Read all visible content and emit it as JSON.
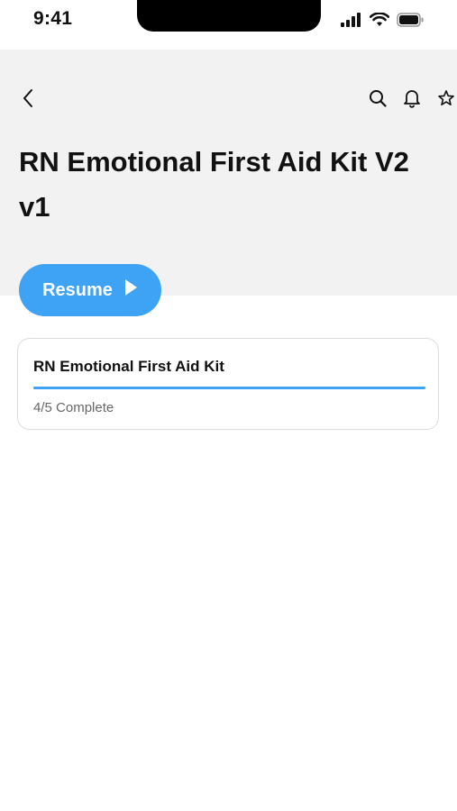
{
  "status_bar": {
    "time": "9:41"
  },
  "header": {
    "title": "RN Emotional First Aid Kit V2 v1",
    "icons": [
      "chevron-left-icon",
      "search-icon",
      "bell-icon",
      "star-icon"
    ]
  },
  "resume_button": {
    "label": "Resume"
  },
  "course_card": {
    "title": "RN Emotional First Aid Kit",
    "progress_fraction": 0.8,
    "progress_text": "4/5 Complete"
  },
  "colors": {
    "accent": "#3ea3f5",
    "header_bg": "#f2f2f2"
  }
}
